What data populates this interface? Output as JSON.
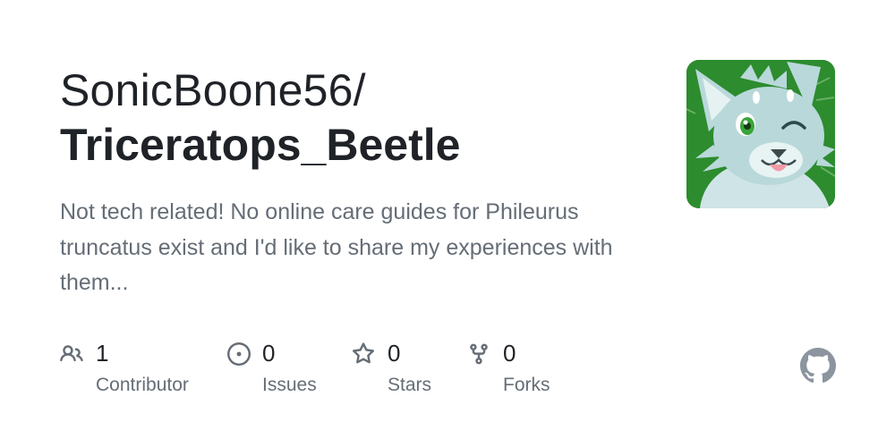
{
  "repo_card": {
    "owner": "SonicBoone56/",
    "name": "Triceratops_Beetle",
    "description": "Not tech related! No online care guides for Phileurus truncatus exist and I'd like to share my experiences with them...",
    "avatar_icon": "furry-character-avatar",
    "avatar_background": "#2c8c2e"
  },
  "stats": [
    {
      "icon": "people-icon",
      "count": "1",
      "label": "Contributor"
    },
    {
      "icon": "issue-icon",
      "count": "0",
      "label": "Issues"
    },
    {
      "icon": "star-icon",
      "count": "0",
      "label": "Stars"
    },
    {
      "icon": "fork-icon",
      "count": "0",
      "label": "Forks"
    }
  ],
  "logo_icon": "github-mark-icon",
  "colors": {
    "text_primary": "#1f2328",
    "text_secondary": "#656d76",
    "icon_gray": "#656d76"
  }
}
